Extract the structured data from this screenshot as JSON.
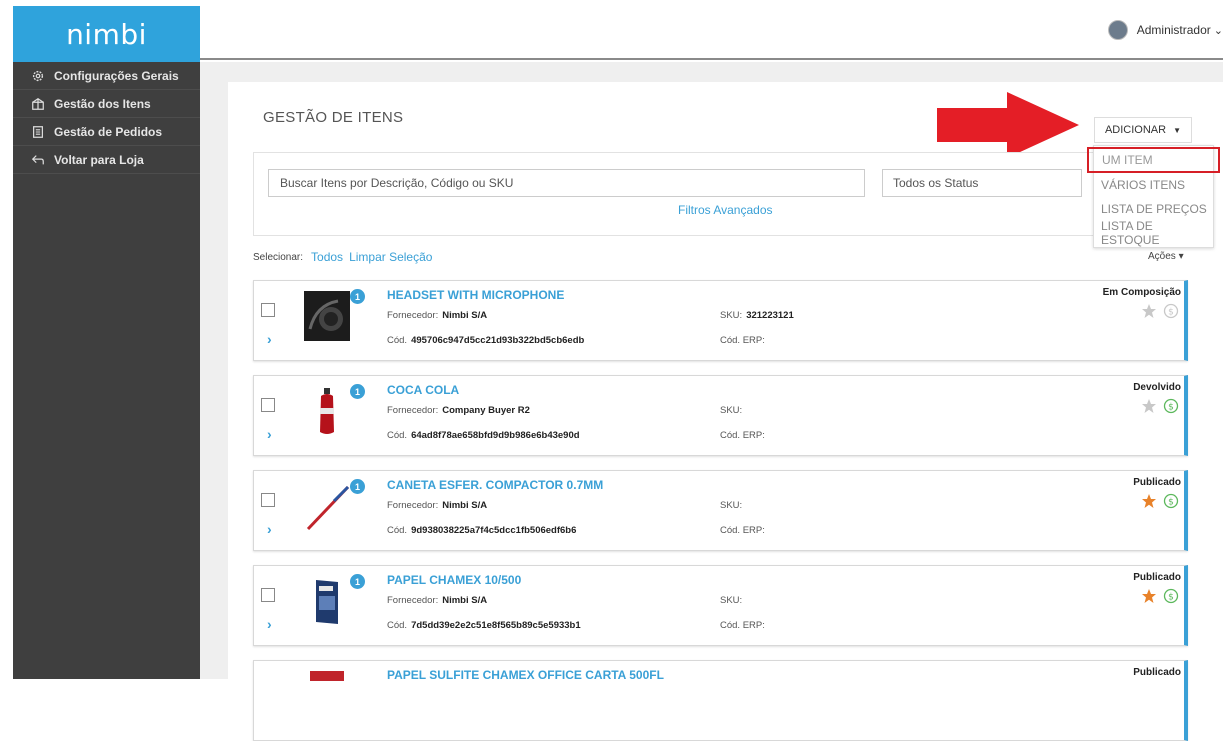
{
  "app": {
    "logo": "nimbi"
  },
  "user": {
    "name": "Administrador",
    "caret": "⌄"
  },
  "sidebar": {
    "items": [
      {
        "label": "Configurações Gerais",
        "icon": "gear-icon"
      },
      {
        "label": "Gestão dos Itens",
        "icon": "items-icon"
      },
      {
        "label": "Gestão de Pedidos",
        "icon": "orders-icon"
      },
      {
        "label": "Voltar para Loja",
        "icon": "back-arrow-icon"
      }
    ]
  },
  "page": {
    "title": "GESTÃO DE ITENS"
  },
  "toolbar": {
    "add_label": "ADICIONAR",
    "add_caret": "▼",
    "add_menu": [
      "UM ITEM",
      "VÁRIOS ITENS",
      "LISTA DE PREÇOS",
      "LISTA DE ESTOQUE"
    ]
  },
  "filters": {
    "search_placeholder": "Buscar Itens por Descrição, Código ou SKU",
    "status_value": "Todos os Status",
    "advanced_label": "Filtros Avançados"
  },
  "selection": {
    "label": "Selecionar:",
    "all_label": "Todos",
    "clear_label": "Limpar Seleção",
    "actions_label": "Ações ▾"
  },
  "labels": {
    "supplier": "Fornecedor:",
    "code": "Cód.",
    "sku": "SKU:",
    "erp": "Cód. ERP:"
  },
  "items": [
    {
      "name": "HEADSET WITH MICROPHONE",
      "supplier": "Nimbi S/A",
      "code": "495706c947d5cc21d93b322bd5cb6edb",
      "sku": "321223121",
      "status": "Em Composição",
      "badge": "1",
      "starred": false,
      "price_active": false
    },
    {
      "name": "COCA COLA",
      "supplier": "Company Buyer R2",
      "code": "64ad8f78ae658bfd9d9b986e6b43e90d",
      "sku": "",
      "status": "Devolvido",
      "badge": "1",
      "starred": false,
      "price_active": true
    },
    {
      "name": "CANETA ESFER. COMPACTOR 0.7MM",
      "supplier": "Nimbi S/A",
      "code": "9d938038225a7f4c5dcc1fb506edf6b6",
      "sku": "",
      "status": "Publicado",
      "badge": "1",
      "starred": true,
      "price_active": true
    },
    {
      "name": "PAPEL CHAMEX 10/500",
      "supplier": "Nimbi S/A",
      "code": "7d5dd39e2e2c51e8f565b89c5e5933b1",
      "sku": "",
      "status": "Publicado",
      "badge": "1",
      "starred": true,
      "price_active": true
    },
    {
      "name": "PAPEL SULFITE CHAMEX OFFICE CARTA 500FL",
      "supplier": "",
      "code": "",
      "sku": "",
      "status": "Publicado",
      "badge": "",
      "starred": false,
      "price_active": false
    }
  ],
  "colors": {
    "accent": "#3aa0d6",
    "sidebar": "#3f3f3f",
    "star_active": "#e8822a",
    "price_active": "#5cb85c",
    "highlight": "#d61f26"
  }
}
